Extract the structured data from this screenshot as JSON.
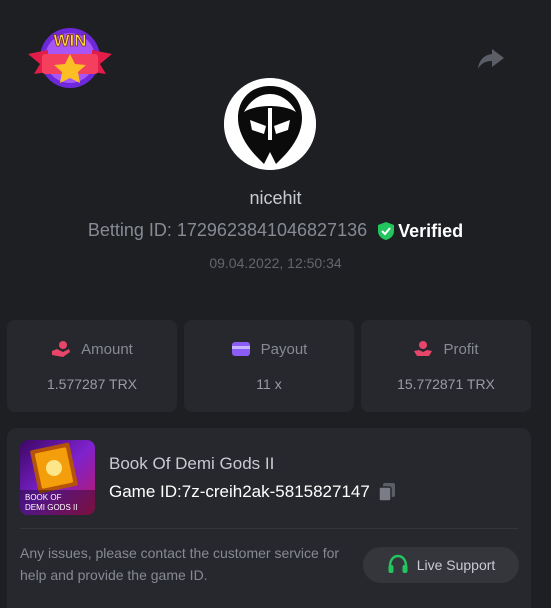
{
  "header": {
    "badge_text": "WIN",
    "share_icon": "share-icon"
  },
  "profile": {
    "username": "nicehit",
    "betting_label": "Betting ID:",
    "betting_id": "1729623841046827136",
    "verified_label": "Verified",
    "timestamp": "09.04.2022, 12:50:34"
  },
  "stats": [
    {
      "label": "Amount",
      "value": "1.577287 TRX",
      "icon": "hand-coin-icon",
      "color": "#e8456a"
    },
    {
      "label": "Payout",
      "value": "11 x",
      "icon": "wallet-icon",
      "color": "#8b5cf6"
    },
    {
      "label": "Profit",
      "value": "15.772871 TRX",
      "icon": "hand-money-icon",
      "color": "#e8456a"
    }
  ],
  "game": {
    "title": "Book Of Demi Gods II",
    "id_label": "Game ID:",
    "id_value": "7z-creih2ak-5815827147",
    "thumb_text_line1": "BOOK OF",
    "thumb_text_line2": "DEMI GODS II"
  },
  "support": {
    "help_text": "Any issues, please contact the customer service for help and provide the game ID.",
    "button_label": "Live Support"
  },
  "colors": {
    "background": "#1e1f23",
    "card": "#27282d",
    "verified_green": "#22c55e",
    "support_icon_green": "#22c55e"
  }
}
